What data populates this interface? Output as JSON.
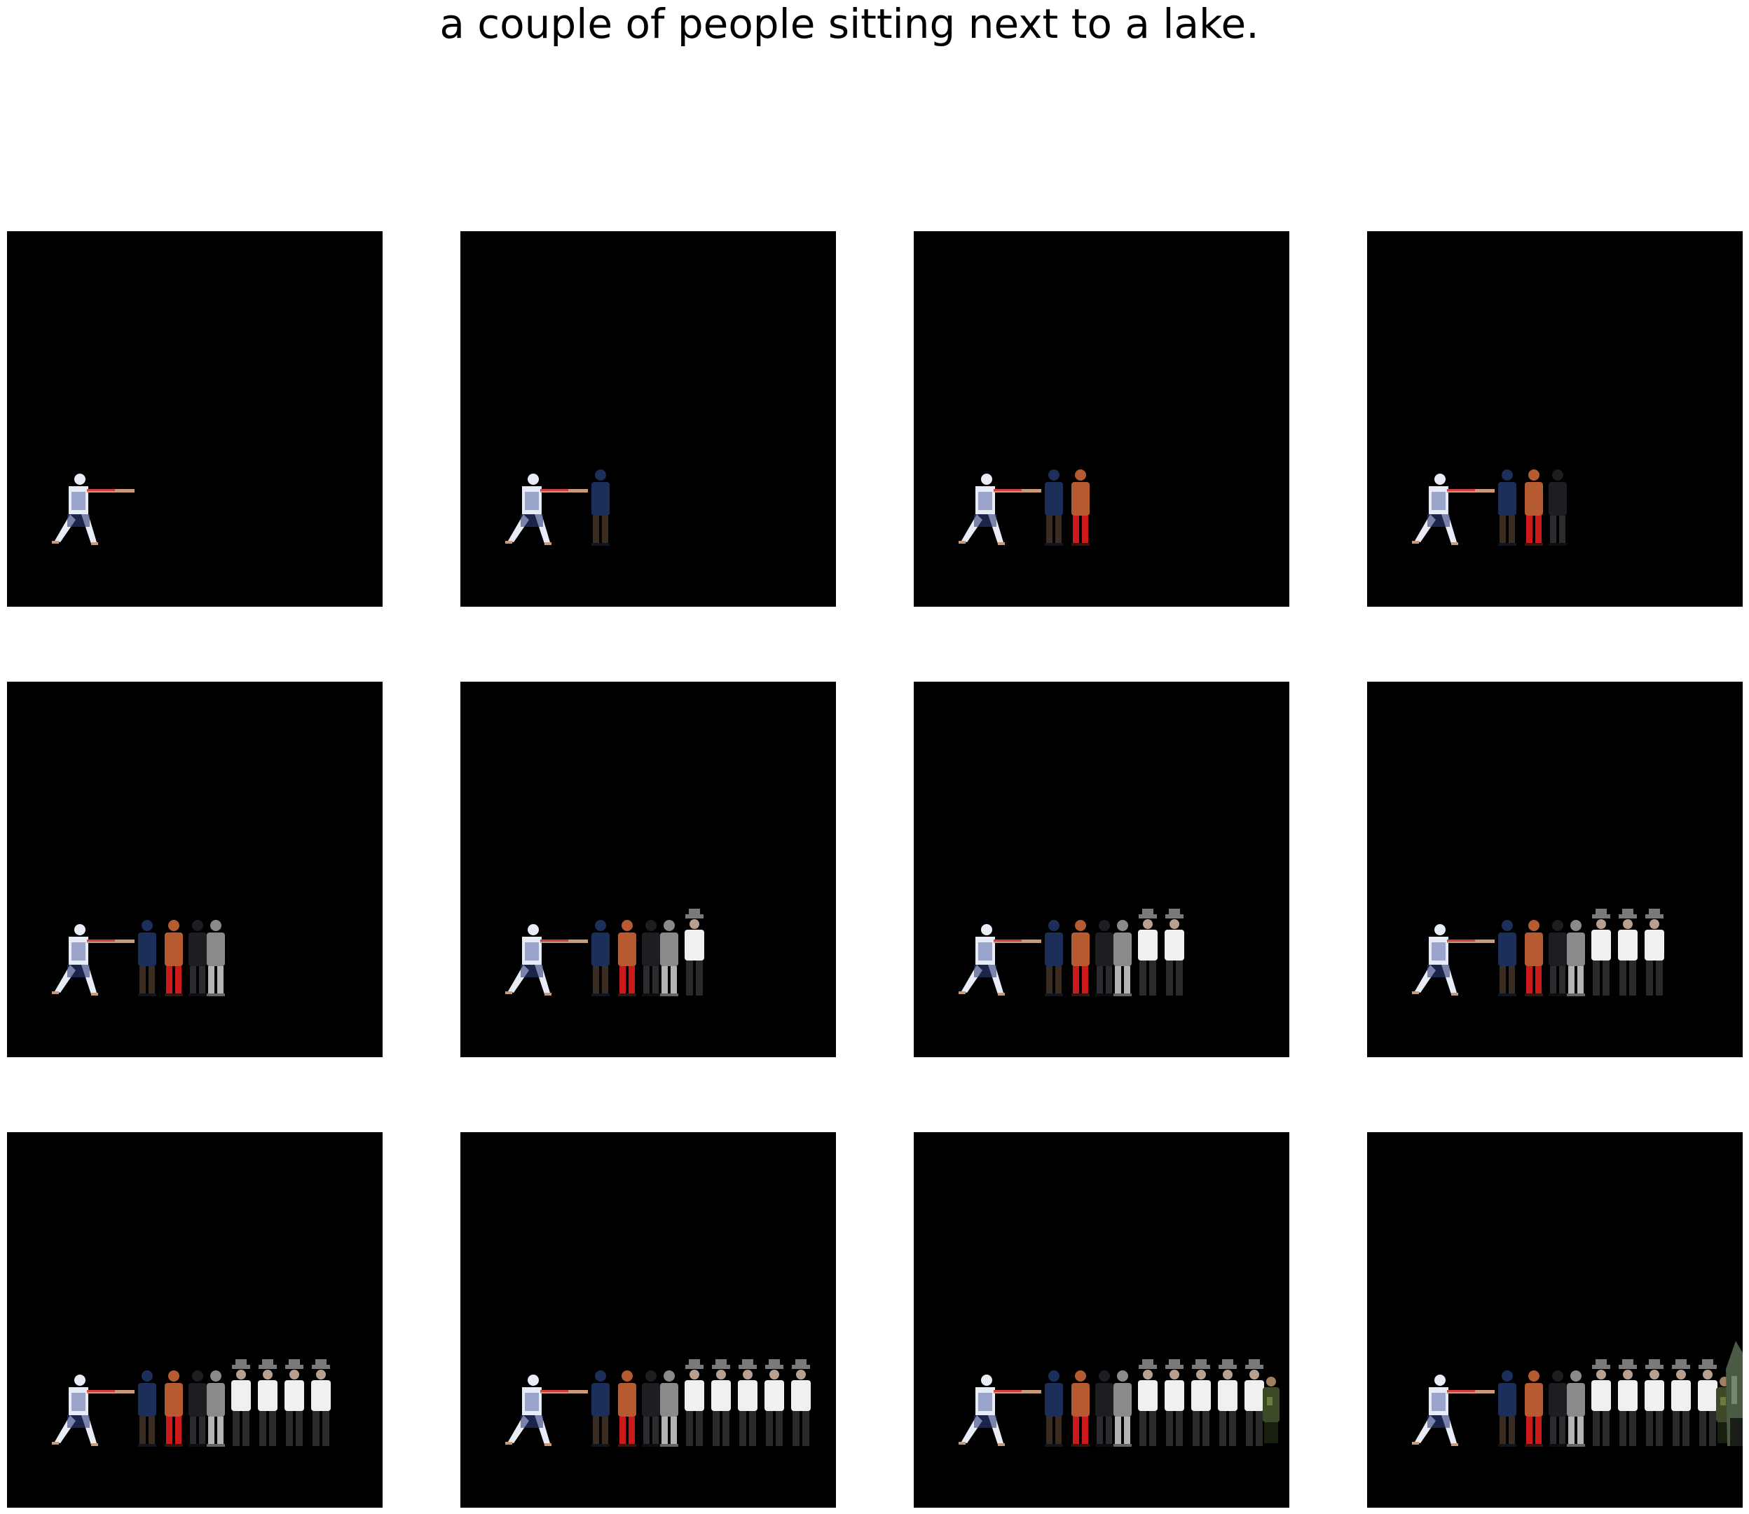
{
  "caption": "a couple of people sitting next to a lake.",
  "panel_background": "#000000",
  "figures": [
    {
      "kind": "pointing-person",
      "colors": [
        "#e8ecf6",
        "#5b6aa6",
        "#2f3d7a",
        "#c89a7a"
      ]
    },
    {
      "kind": "standing-person",
      "colors": [
        "#1c2e5a",
        "#3a2c20",
        "#101522"
      ]
    },
    {
      "kind": "standing-person",
      "colors": [
        "#b65a32",
        "#cc1a1a",
        "#301810"
      ]
    },
    {
      "kind": "standing-person",
      "colors": [
        "#1e1e22",
        "#2c2c30",
        "#0e0e10"
      ]
    },
    {
      "kind": "standing-person",
      "colors": [
        "#8a8a8a",
        "#b4b4b4",
        "#666666"
      ]
    },
    {
      "kind": "hat-person",
      "colors": [
        "#f0f0f0",
        "#2a2a2a",
        "#7a7a7a"
      ]
    },
    {
      "kind": "hat-person",
      "colors": [
        "#f0f0f0",
        "#2a2a2a",
        "#7a7a7a"
      ]
    },
    {
      "kind": "hat-person",
      "colors": [
        "#f0f0f0",
        "#2a2a2a",
        "#7a7a7a"
      ]
    },
    {
      "kind": "hat-person",
      "colors": [
        "#f0f0f0",
        "#2a2a2a",
        "#7a7a7a"
      ]
    },
    {
      "kind": "hat-person",
      "colors": [
        "#f0f0f0",
        "#2a2a2a",
        "#7a7a7a"
      ]
    },
    {
      "kind": "camo-person",
      "colors": [
        "#3c4a28",
        "#1a2010",
        "#6a7a40"
      ]
    },
    {
      "kind": "camo-person-large",
      "colors": [
        "#4a5a44",
        "#1a1e18",
        "#8a9a80"
      ]
    }
  ],
  "panels": [
    {
      "figure_count": 1
    },
    {
      "figure_count": 2
    },
    {
      "figure_count": 3
    },
    {
      "figure_count": 4
    },
    {
      "figure_count": 5
    },
    {
      "figure_count": 6
    },
    {
      "figure_count": 7
    },
    {
      "figure_count": 8
    },
    {
      "figure_count": 9
    },
    {
      "figure_count": 10
    },
    {
      "figure_count": 11
    },
    {
      "figure_count": 12
    }
  ]
}
